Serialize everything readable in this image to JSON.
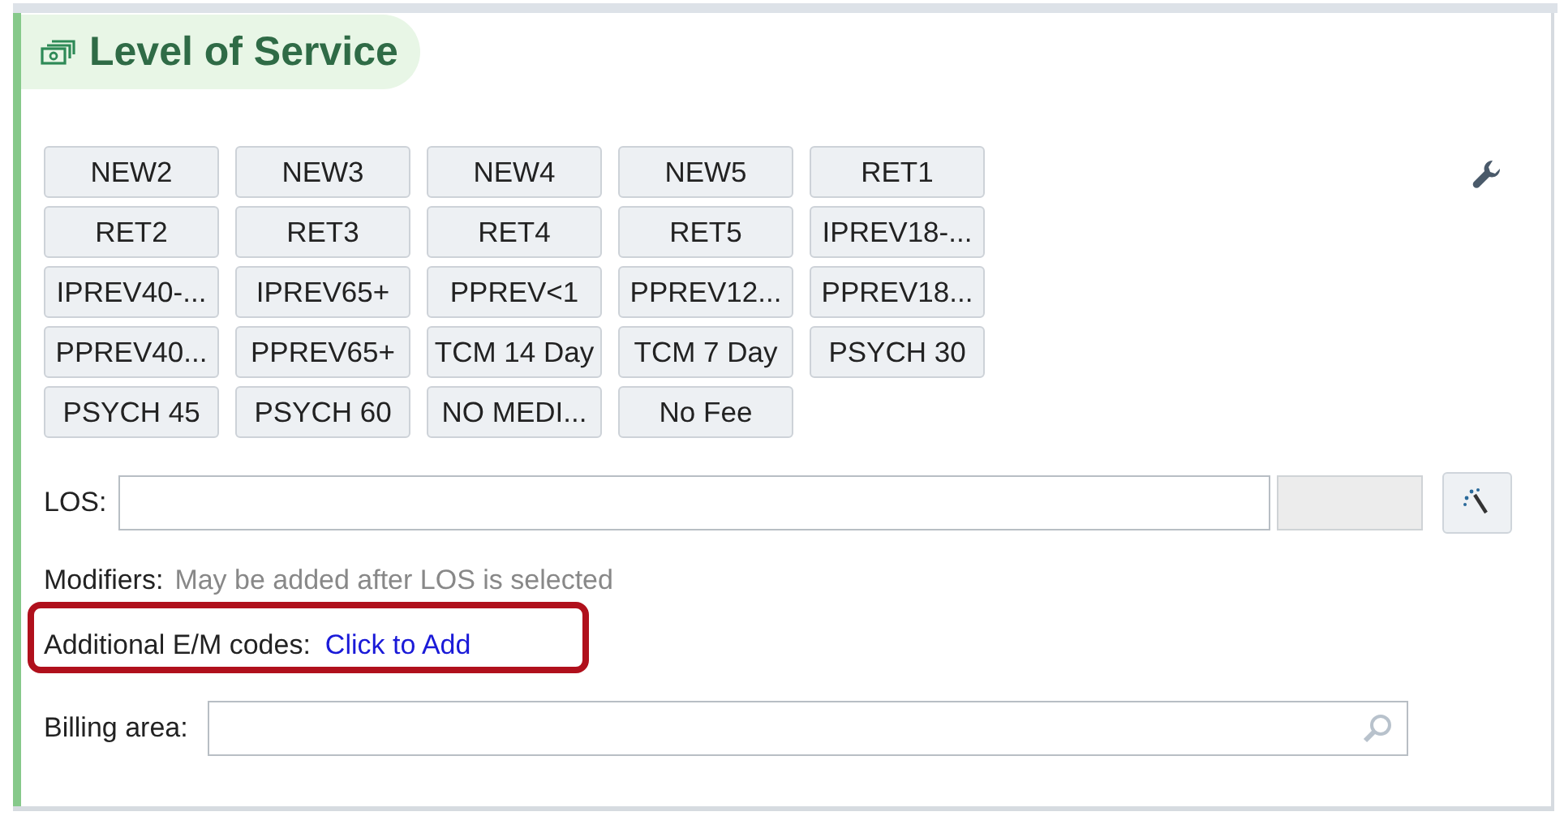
{
  "panel": {
    "title": "Level of Service"
  },
  "los_buttons": [
    "NEW2",
    "NEW3",
    "NEW4",
    "NEW5",
    "RET1",
    "RET2",
    "RET3",
    "RET4",
    "RET5",
    "IPREV18-...",
    "IPREV40-...",
    "IPREV65+",
    "PPREV<1",
    "PPREV12...",
    "PPREV18...",
    "PPREV40...",
    "PPREV65+",
    "TCM 14 Day",
    "TCM 7 Day",
    "PSYCH 30",
    "PSYCH 45",
    "PSYCH 60",
    "NO MEDI...",
    "No Fee"
  ],
  "los": {
    "label": "LOS:"
  },
  "modifiers": {
    "label": "Modifiers:",
    "hint": "May be added after LOS is selected"
  },
  "additional_codes": {
    "label": "Additional E/M codes:",
    "link": "Click to Add"
  },
  "billing_area": {
    "label": "Billing area:"
  }
}
